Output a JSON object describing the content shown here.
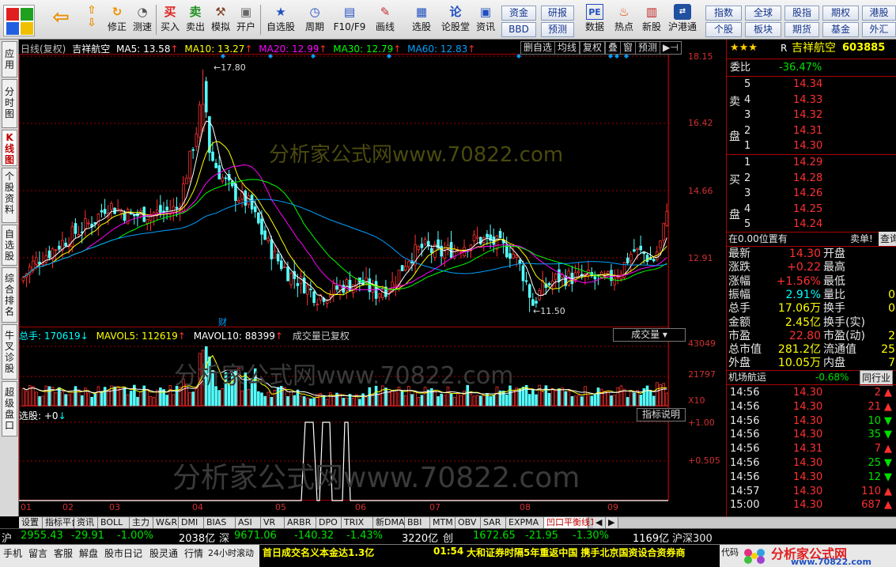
{
  "toolbar": {
    "buttons": [
      {
        "label": "",
        "icon": "back-arrow-icon"
      },
      {
        "label": "",
        "icon": "up-down-icon"
      },
      {
        "label": "修正",
        "icon": "refresh-icon"
      },
      {
        "label": "测速",
        "icon": "clock-icon"
      },
      {
        "label": "买入",
        "icon": "buy-icon"
      },
      {
        "label": "卖出",
        "icon": "sell-icon"
      },
      {
        "label": "模拟",
        "icon": "hammer-icon"
      },
      {
        "label": "开户",
        "icon": "lock-icon"
      },
      {
        "label": "自选股",
        "icon": "star-window-icon"
      },
      {
        "label": "周期",
        "icon": "cycle-icon"
      },
      {
        "label": "F10/F9",
        "icon": "f10-icon"
      },
      {
        "label": "画线",
        "icon": "pencil-icon"
      },
      {
        "label": "选股",
        "icon": "screen-icon"
      },
      {
        "label": "论股堂",
        "icon": "lun-icon"
      },
      {
        "label": "资讯",
        "icon": "news-icon"
      },
      {
        "label": "数据",
        "icon": "pe-icon"
      },
      {
        "label": "热点",
        "icon": "fire-icon"
      },
      {
        "label": "新股",
        "icon": "new-stock-icon"
      },
      {
        "label": "沪港通",
        "icon": "sse-hkex-icon"
      }
    ],
    "small_buttons": [
      "资金",
      "研报",
      "BBD",
      "预测",
      "指数",
      "全球",
      "股指",
      "期权",
      "港股",
      "个股",
      "板块",
      "期货",
      "基金",
      "外汇"
    ]
  },
  "sidetabs": [
    "应用",
    "分时图",
    "K线图",
    "个股资料",
    "自选股",
    "综合排名",
    "牛叉诊股",
    "超级盘口"
  ],
  "chart": {
    "header": {
      "period": "日线(复权)",
      "name": "吉祥航空",
      "ma5": "MA5: 13.58",
      "ma10": "MA10: 13.27",
      "ma20": "MA20: 12.99",
      "ma30": "MA30: 12.79",
      "ma60": "MA60: 12.83"
    },
    "top_buttons": [
      "删自选",
      "均线",
      "复权",
      "叠",
      "窗",
      "预测"
    ],
    "price_axis": [
      "18.15",
      "16.42",
      "14.66",
      "12.91"
    ],
    "high_label": "17.80",
    "low_label": "11.50",
    "fin_label": "财",
    "volume_header": {
      "total": "总手: 170619",
      "mavol5": "MAVOL5: 112619",
      "mavol10": "MAVOL10: 88399",
      "note": "成交量已复权",
      "selector": "成交量"
    },
    "volume_axis": [
      "43049",
      "21797",
      "X10"
    ],
    "indicator_header": {
      "label": "选股: +0",
      "button": "指标说明"
    },
    "indicator_axis": [
      "+1.00",
      "+0.505"
    ],
    "months": [
      "01",
      "02",
      "03",
      "04",
      "05",
      "06",
      "07",
      "08",
      "09"
    ],
    "watermark": "分析家公式网www.70822.com",
    "colors": {
      "up": "#ff3030",
      "down": "#54ffff",
      "ma5": "#ffffff",
      "ma10": "#ffff00",
      "ma20": "#ff00ff",
      "ma30": "#00ff00",
      "ma60": "#00a0ff"
    }
  },
  "chart_data": {
    "type": "candlestick",
    "symbol": "603885",
    "name": "吉祥航空",
    "ylim": [
      11.0,
      18.15
    ],
    "high": 17.8,
    "low": 11.5,
    "ma": {
      "MA5": 13.58,
      "MA10": 13.27,
      "MA20": 12.99,
      "MA30": 12.79,
      "MA60": 12.83
    },
    "volume": {
      "total": 170619,
      "MAVOL5": 112619,
      "MAVOL10": 88399,
      "axis": [
        21797,
        43049
      ]
    },
    "months": [
      "01",
      "02",
      "03",
      "04",
      "05",
      "06",
      "07",
      "08",
      "09"
    ]
  },
  "quote": {
    "stars": "★★★",
    "rflag": "R",
    "name": "吉祥航空",
    "code": "603885",
    "weibi_label": "委比",
    "weibi": "-36.47%",
    "sell_label": [
      "卖",
      "盘"
    ],
    "buy_label": [
      "买",
      "盘"
    ],
    "sell": [
      {
        "n": "5",
        "p": "14.34"
      },
      {
        "n": "4",
        "p": "14.33"
      },
      {
        "n": "3",
        "p": "14.32"
      },
      {
        "n": "2",
        "p": "14.31"
      },
      {
        "n": "1",
        "p": "14.30"
      }
    ],
    "buy": [
      {
        "n": "1",
        "p": "14.29"
      },
      {
        "n": "2",
        "p": "14.28"
      },
      {
        "n": "3",
        "p": "14.26"
      },
      {
        "n": "4",
        "p": "14.25"
      },
      {
        "n": "5",
        "p": "14.24"
      }
    ],
    "position_label": "在0.00位置有",
    "trade_label": "卖单!",
    "check_label": "查询",
    "stats": [
      {
        "k": "最新",
        "v": "14.30",
        "k2": "开盘"
      },
      {
        "k": "涨跌",
        "v": "+0.22",
        "k2": "最高"
      },
      {
        "k": "涨幅",
        "v": "+1.56%",
        "k2": "最低"
      },
      {
        "k": "振幅",
        "v": "2.91%",
        "k2": "量比"
      },
      {
        "k": "总手",
        "v": "17.06万",
        "k2": "换手"
      },
      {
        "k": "金额",
        "v": "2.45亿",
        "k2": "换手(实)"
      },
      {
        "k": "市盈",
        "v": "22.80",
        "k2": "市盈(动)"
      },
      {
        "k": "总市值",
        "v": "281.2亿",
        "k2": "流通值"
      },
      {
        "k": "外盘",
        "v": "10.05万",
        "k2": "内盘"
      }
    ],
    "stats_right": [
      "",
      "",
      "",
      "0",
      "0",
      "",
      "2",
      "25",
      "7"
    ],
    "industry": "机场航运",
    "industry_chg": "-0.68%",
    "industry_btn": "同行业",
    "ticks": [
      {
        "t": "14:56",
        "p": "14.30",
        "v": "2",
        "d": "up"
      },
      {
        "t": "14:56",
        "p": "14.30",
        "v": "21",
        "d": "up"
      },
      {
        "t": "14:56",
        "p": "14.30",
        "v": "10",
        "d": "down"
      },
      {
        "t": "14:56",
        "p": "14.30",
        "v": "35",
        "d": "down"
      },
      {
        "t": "14:56",
        "p": "14.31",
        "v": "7",
        "d": "up"
      },
      {
        "t": "14:56",
        "p": "14.30",
        "v": "25",
        "d": "down"
      },
      {
        "t": "14:56",
        "p": "14.30",
        "v": "12",
        "d": "down"
      },
      {
        "t": "14:57",
        "p": "14.30",
        "v": "110",
        "d": "up"
      },
      {
        "t": "15:00",
        "p": "14.30",
        "v": "687",
        "d": "up"
      }
    ]
  },
  "bottom_tabs": [
    "设置",
    "指标平台",
    "资讯",
    "BOLL",
    "主力",
    "W&R",
    "DMI",
    "BIAS",
    "ASI",
    "VR",
    "ARBR",
    "DPO",
    "TRIX",
    "新DMA",
    "BBI",
    "MTM",
    "OBV",
    "SAR",
    "EXPMA",
    "凹口平衡线1"
  ],
  "status": {
    "sh": "沪",
    "sh_idx": "2955.43",
    "sh_chg": "-29.91",
    "sh_pct": "-1.00%",
    "sh_amt": "2038亿",
    "sz": "深",
    "sz_idx": "9671.06",
    "sz_chg": "-140.32",
    "sz_pct": "-1.43%",
    "sz_amt": "3220亿",
    "cy": "创",
    "cy_idx": "1672.65",
    "cy_chg": "-21.95",
    "cy_pct": "-1.30%",
    "hs_amt": "1169亿",
    "hs300": "沪深300"
  },
  "status2": {
    "items": [
      "手机",
      "留言",
      "客服",
      "解盘",
      "股市日记",
      "股灵通",
      "行情",
      "24小时滚动"
    ],
    "news1": "首日成交名义本金达1.3亿",
    "time": "01:54",
    "news2": "大和证券时隔5年重返中国 携手北京国资设合资券商",
    "right": "代码",
    "brand": "分析家公式网",
    "brand_url": "www.70822.com"
  }
}
